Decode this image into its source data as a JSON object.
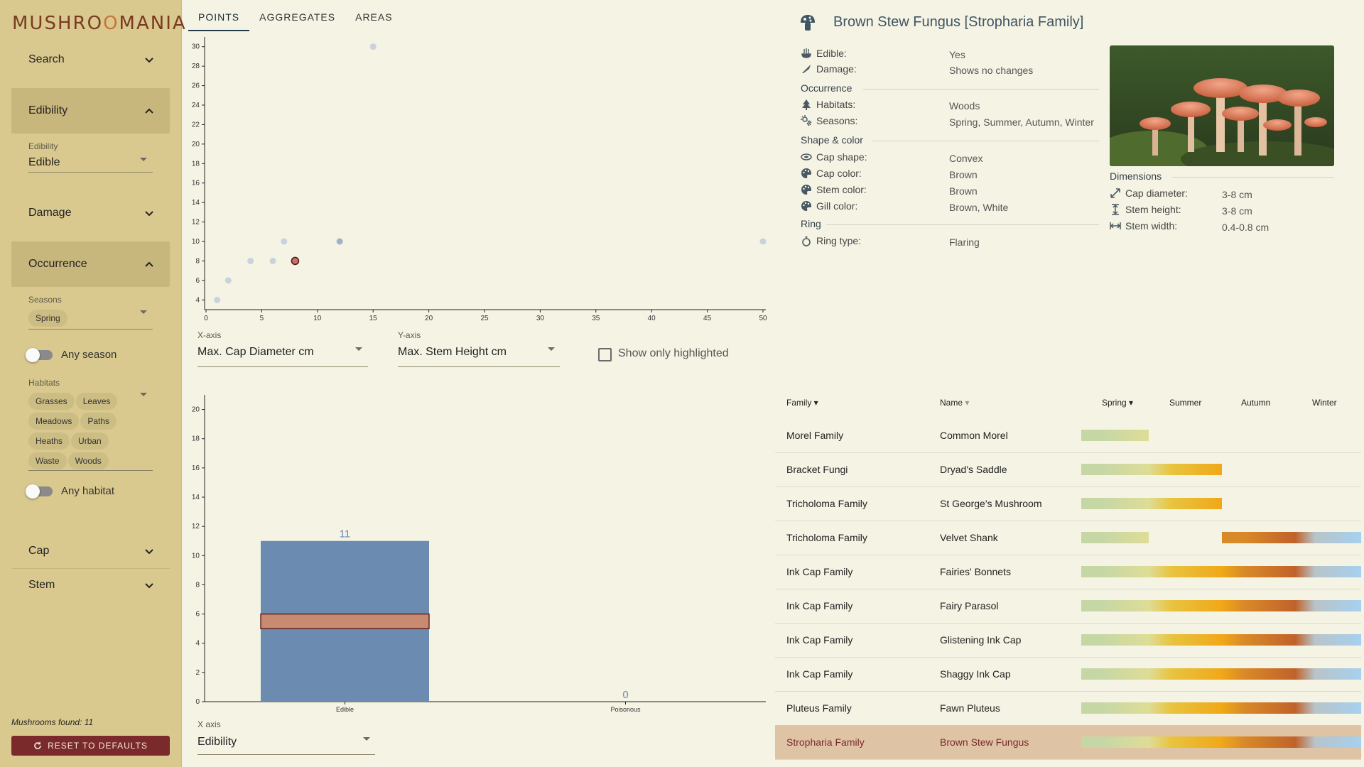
{
  "app": {
    "logo_text": "MUSHROOMANIA"
  },
  "sidebar": {
    "search": "Search",
    "edibility": {
      "header": "Edibility",
      "label": "Edibility",
      "value": "Edible"
    },
    "damage": "Damage",
    "occurrence": {
      "header": "Occurrence",
      "seasons_label": "Seasons",
      "seasons": [
        "Spring"
      ],
      "any_season": "Any season",
      "habitats_label": "Habitats",
      "habitats": [
        "Grasses",
        "Leaves",
        "Meadows",
        "Paths",
        "Heaths",
        "Urban",
        "Waste",
        "Woods"
      ],
      "any_habitat": "Any habitat"
    },
    "cap": "Cap",
    "stem": "Stem",
    "found_label": "Mushrooms found: 11",
    "reset_label": "RESET TO DEFAULTS"
  },
  "tabs": [
    "POINTS",
    "AGGREGATES",
    "AREAS"
  ],
  "scatter": {
    "x_axis_label": "X-axis",
    "x_axis_value": "Max. Cap Diameter cm",
    "y_axis_label": "Y-axis",
    "y_axis_value": "Max. Stem Height cm",
    "show_only_highlighted": "Show only highlighted"
  },
  "aggregates": {
    "x_axis_label": "X axis",
    "x_axis_value": "Edibility"
  },
  "chart_data": [
    {
      "type": "scatter",
      "xlim": [
        0,
        50
      ],
      "ylim": [
        3,
        31
      ],
      "x_ticks": [
        0,
        5,
        10,
        15,
        20,
        25,
        30,
        35,
        40,
        45,
        50
      ],
      "y_ticks": [
        4,
        6,
        8,
        10,
        12,
        14,
        16,
        18,
        20,
        22,
        24,
        26,
        28,
        30
      ],
      "points": [
        {
          "x": 1,
          "y": 4,
          "kind": "normal"
        },
        {
          "x": 2,
          "y": 6,
          "kind": "normal"
        },
        {
          "x": 4,
          "y": 8,
          "kind": "normal"
        },
        {
          "x": 6,
          "y": 8,
          "kind": "normal"
        },
        {
          "x": 7,
          "y": 10,
          "kind": "normal"
        },
        {
          "x": 8,
          "y": 8,
          "kind": "selected"
        },
        {
          "x": 12,
          "y": 10,
          "kind": "highlighted"
        },
        {
          "x": 15,
          "y": 30,
          "kind": "normal"
        },
        {
          "x": 50,
          "y": 10,
          "kind": "normal"
        }
      ],
      "colors": {
        "normal": "#c9d3dc",
        "highlighted": "#9fb3c6",
        "selected": "#c9726a"
      }
    },
    {
      "type": "bar",
      "categories": [
        "Edible",
        "Poisonous"
      ],
      "values": [
        11,
        0
      ],
      "highlight_values": [
        1,
        0
      ],
      "ylim": [
        0,
        21
      ],
      "y_ticks": [
        0,
        2,
        4,
        6,
        8,
        10,
        12,
        14,
        16,
        18,
        20
      ],
      "colors": {
        "bar": "#6b8cb0",
        "highlight": "#c98a72",
        "label": "#6b8cb0"
      }
    }
  ],
  "details": {
    "title": "Brown Stew Fungus [Stropharia Family]",
    "rows": [
      {
        "label": "Edible:",
        "value": "Yes",
        "icon": "bowl-icon"
      },
      {
        "label": "Damage:",
        "value": "Shows no changes",
        "icon": "knife-icon"
      }
    ],
    "occurrence_title": "Occurrence",
    "occurrence": [
      {
        "label": "Habitats:",
        "value": "Woods",
        "icon": "tree-icon"
      },
      {
        "label": "Seasons:",
        "value": "Spring, Summer, Autumn, Winter",
        "icon": "weather-icon"
      }
    ],
    "shape_title": "Shape & color",
    "shape": [
      {
        "label": "Cap shape:",
        "value": "Convex",
        "icon": "cap-shape-icon"
      },
      {
        "label": "Cap color:",
        "value": "Brown",
        "icon": "palette-icon"
      },
      {
        "label": "Stem color:",
        "value": "Brown",
        "icon": "palette-icon"
      },
      {
        "label": "Gill color:",
        "value": "Brown, White",
        "icon": "palette-icon"
      }
    ],
    "ring_title": "Ring",
    "ring": [
      {
        "label": "Ring type:",
        "value": "Flaring",
        "icon": "ring-icon"
      }
    ],
    "dimensions_title": "Dimensions",
    "dimensions": [
      {
        "label": "Cap diameter:",
        "value": "3-8 cm",
        "icon": "diagonal-arrow-icon"
      },
      {
        "label": "Stem height:",
        "value": "3-8 cm",
        "icon": "vertical-arrow-icon"
      },
      {
        "label": "Stem width:",
        "value": "0.4-0.8 cm",
        "icon": "horizontal-arrow-icon"
      }
    ]
  },
  "table": {
    "headers": {
      "family": "Family",
      "name": "Name",
      "spring": "Spring",
      "summer": "Summer",
      "autumn": "Autumn",
      "winter": "Winter"
    },
    "rows": [
      {
        "family": "Morel Family",
        "name": "Common Morel",
        "seasons": [
          1,
          0,
          0,
          0
        ]
      },
      {
        "family": "Bracket Fungi",
        "name": "Dryad's Saddle",
        "seasons": [
          1,
          1,
          0,
          0
        ]
      },
      {
        "family": "Tricholoma Family",
        "name": "St George's Mushroom",
        "seasons": [
          1,
          1,
          0,
          0
        ]
      },
      {
        "family": "Tricholoma Family",
        "name": "Velvet Shank",
        "seasons": [
          1,
          0,
          1,
          1
        ]
      },
      {
        "family": "Ink Cap Family",
        "name": "Fairies' Bonnets",
        "seasons": [
          1,
          1,
          1,
          1
        ]
      },
      {
        "family": "Ink Cap Family",
        "name": "Fairy Parasol",
        "seasons": [
          1,
          1,
          1,
          1
        ]
      },
      {
        "family": "Ink Cap Family",
        "name": "Glistening Ink Cap",
        "seasons": [
          1,
          1,
          1,
          1
        ]
      },
      {
        "family": "Ink Cap Family",
        "name": "Shaggy Ink Cap",
        "seasons": [
          1,
          1,
          1,
          1
        ]
      },
      {
        "family": "Pluteus Family",
        "name": "Fawn Pluteus",
        "seasons": [
          1,
          1,
          1,
          1
        ]
      },
      {
        "family": "Stropharia Family",
        "name": "Brown Stew Fungus",
        "seasons": [
          1,
          1,
          1,
          1
        ],
        "selected": true
      }
    ],
    "season_colors": {
      "spring": [
        "#c6d7a6",
        "#dedd96"
      ],
      "summer": [
        "#e8c440",
        "#f0a818"
      ],
      "autumn": [
        "#d98a28",
        "#c0622a"
      ],
      "winter": [
        "#b8c4c8",
        "#a6d0f0"
      ]
    }
  }
}
